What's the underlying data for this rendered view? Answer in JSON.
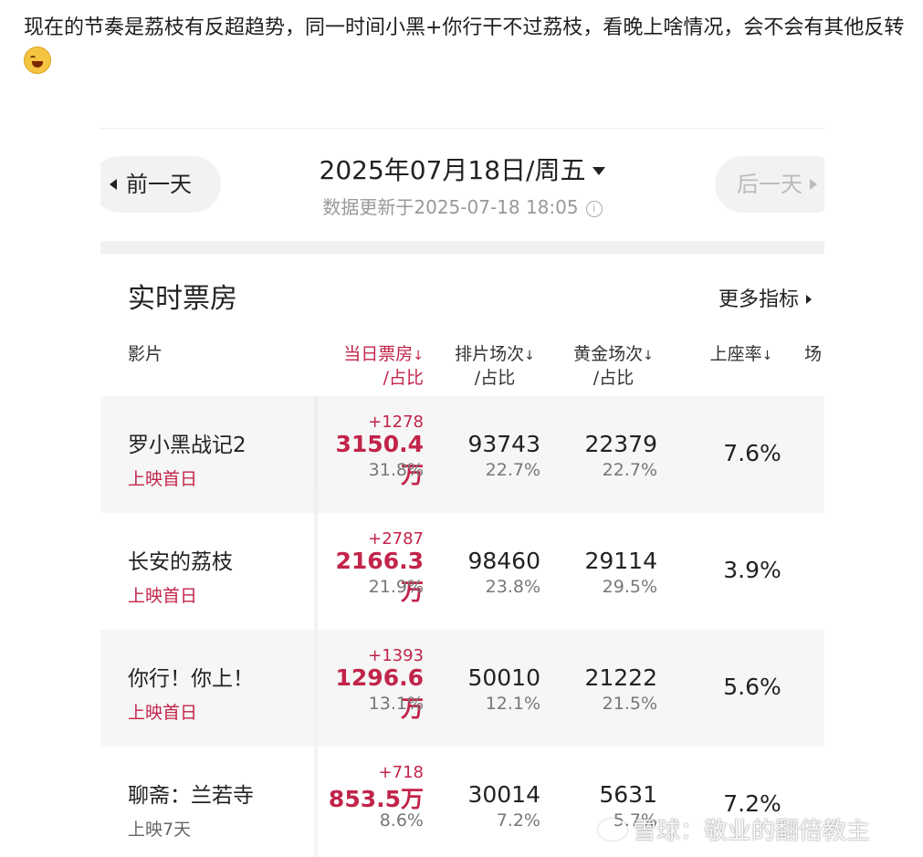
{
  "post": {
    "text": "现在的节奏是荔枝有反超趋势，同一时间小黑+你行干不过荔枝，看晚上啥情况，会不会有其他反转",
    "emoji": "laughing-crying-emoji"
  },
  "screenshot": {
    "prev_day": "前一天",
    "next_day": "后一天",
    "date": "2025年07月18日/周五",
    "updated": "数据更新于2025-07-18  18:05",
    "section_title": "实时票房",
    "more_metrics": "更多指标",
    "headers": {
      "film": "影片",
      "box_office_1": "当日票房",
      "box_office_2": "/占比",
      "screenings_1": "排片场次",
      "screenings_2": "/占比",
      "golden_1": "黄金场次",
      "golden_2": "/占比",
      "occupancy": "上座率",
      "extra": "场",
      "sort_arrow": "↓"
    },
    "rows": [
      {
        "film": "罗小黑战记2",
        "status": "上映首日",
        "delta": "+1278",
        "box_office": "3150.4万",
        "bo_share": "31.8%",
        "screenings": "93743",
        "scr_share": "22.7%",
        "golden": "22379",
        "golden_share": "22.7%",
        "occupancy": "7.6%"
      },
      {
        "film": "长安的荔枝",
        "status": "上映首日",
        "delta": "+2787",
        "box_office": "2166.3万",
        "bo_share": "21.9%",
        "screenings": "98460",
        "scr_share": "23.8%",
        "golden": "29114",
        "golden_share": "29.5%",
        "occupancy": "3.9%"
      },
      {
        "film": "你行！你上！",
        "status": "上映首日",
        "delta": "+1393",
        "box_office": "1296.6万",
        "bo_share": "13.1%",
        "screenings": "50010",
        "scr_share": "12.1%",
        "golden": "21222",
        "golden_share": "21.5%",
        "occupancy": "5.6%"
      },
      {
        "film": "聊斋：兰若寺",
        "status": "上映7天",
        "delta": "+718",
        "box_office": "853.5万",
        "bo_share": "8.6%",
        "screenings": "30014",
        "scr_share": "7.2%",
        "golden": "5631",
        "golden_share": "5.7%",
        "occupancy": "7.2%"
      }
    ],
    "watermark": "雪球：敬业的翻倍教主",
    "colors": {
      "accent_red": "#c2244a",
      "row_shade": "#f6f6f6"
    }
  }
}
